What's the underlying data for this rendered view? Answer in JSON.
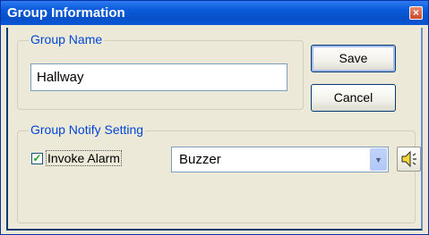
{
  "window": {
    "title": "Group Information",
    "close_icon": "close-icon"
  },
  "group_name": {
    "legend": "Group Name",
    "value": "Hallway"
  },
  "buttons": {
    "save": "Save",
    "cancel": "Cancel"
  },
  "notify": {
    "legend": "Group Notify Setting",
    "invoke_alarm_label": "Invoke Alarm",
    "invoke_alarm_checked": true,
    "alarm_sound": "Buzzer",
    "play_icon": "speaker-icon"
  },
  "colors": {
    "titlebar": "#0b5cdc",
    "legend_text": "#0046d5",
    "face": "#ece9d8"
  }
}
